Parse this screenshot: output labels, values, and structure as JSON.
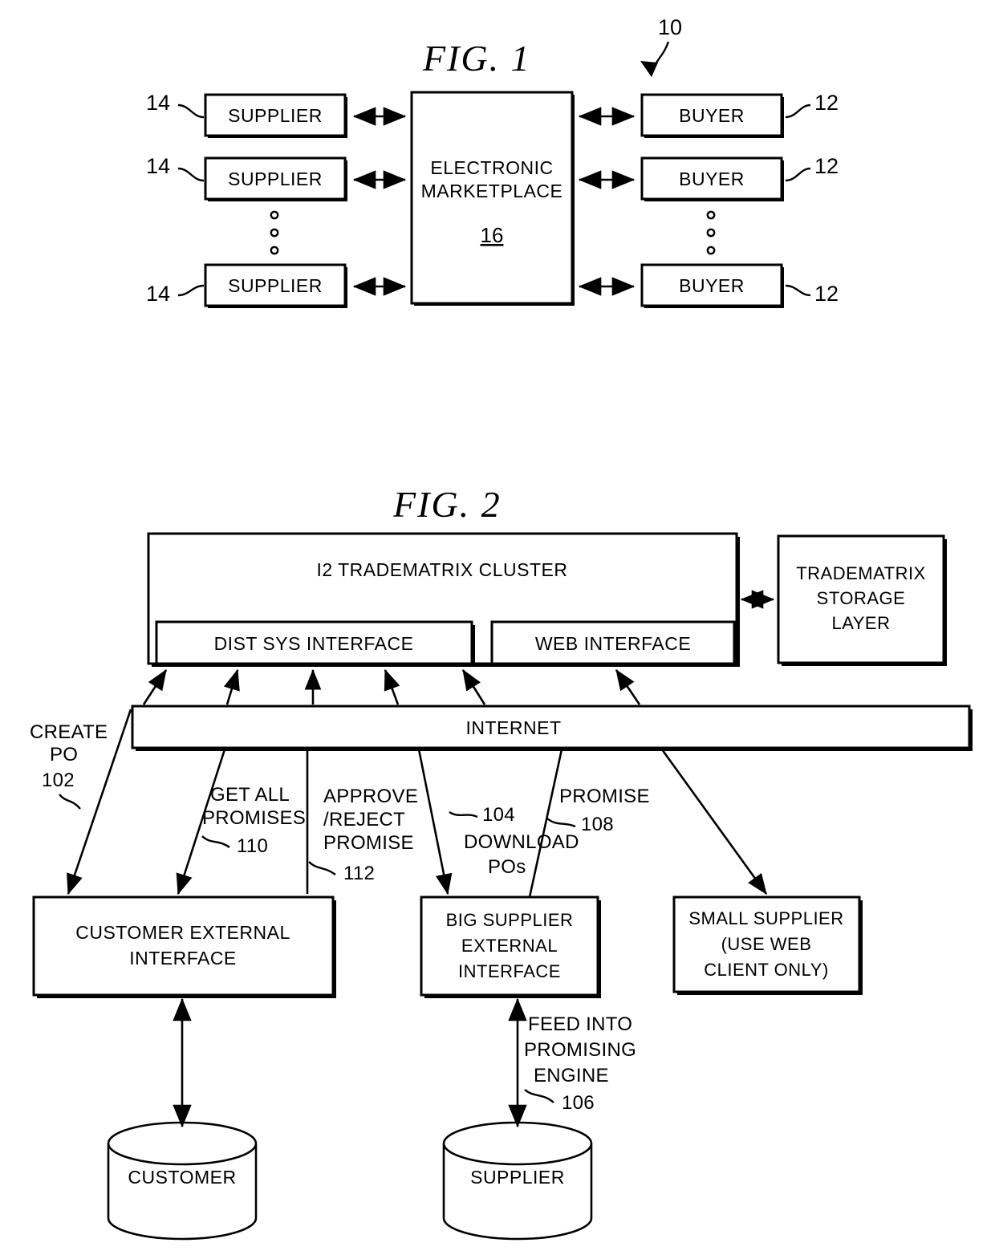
{
  "figure1": {
    "title": "FIG.  1",
    "system_ref": "10",
    "center": {
      "line1": "ELECTRONIC",
      "line2": "MARKETPLACE",
      "ref": "16"
    },
    "suppliers": [
      {
        "label": "SUPPLIER",
        "ref": "14"
      },
      {
        "label": "SUPPLIER",
        "ref": "14"
      },
      {
        "label": "SUPPLIER",
        "ref": "14"
      }
    ],
    "buyers": [
      {
        "label": "BUYER",
        "ref": "12"
      },
      {
        "label": "BUYER",
        "ref": "12"
      },
      {
        "label": "BUYER",
        "ref": "12"
      }
    ]
  },
  "figure2": {
    "title": "FIG.  2",
    "cluster": "I2 TRADEMATRIX CLUSTER",
    "dist_sys_interface": "DIST SYS INTERFACE",
    "web_interface": "WEB INTERFACE",
    "storage_layer": {
      "line1": "TRADEMATRIX",
      "line2": "STORAGE",
      "line3": "LAYER"
    },
    "internet": "INTERNET",
    "flows": [
      {
        "id": "create-po",
        "lines": [
          "CREATE",
          "PO"
        ],
        "ref": "102"
      },
      {
        "id": "get-all-promises",
        "lines": [
          "GET ALL",
          "PROMISES"
        ],
        "ref": "110"
      },
      {
        "id": "approve-reject-promise",
        "lines": [
          "APPROVE",
          "/REJECT",
          "PROMISE"
        ],
        "ref": "112"
      },
      {
        "id": "download-pos",
        "lines": [
          "DOWNLOAD",
          "POs"
        ],
        "ref": "104"
      },
      {
        "id": "promise",
        "lines": [
          "PROMISE"
        ],
        "ref": "108"
      },
      {
        "id": "feed-into-promising-engine",
        "lines": [
          "FEED INTO",
          "PROMISING",
          "ENGINE"
        ],
        "ref": "106"
      }
    ],
    "customer_external_interface": {
      "line1": "CUSTOMER EXTERNAL",
      "line2": "INTERFACE"
    },
    "big_supplier_external_interface": {
      "line1": "BIG SUPPLIER",
      "line2": "EXTERNAL",
      "line3": "INTERFACE"
    },
    "small_supplier": {
      "line1": "SMALL SUPPLIER",
      "line2": "(USE WEB",
      "line3": "CLIENT ONLY)"
    },
    "customer_db": "CUSTOMER",
    "supplier_db": "SUPPLIER"
  },
  "colors": {
    "ink": "#000000",
    "paper": "#ffffff"
  }
}
